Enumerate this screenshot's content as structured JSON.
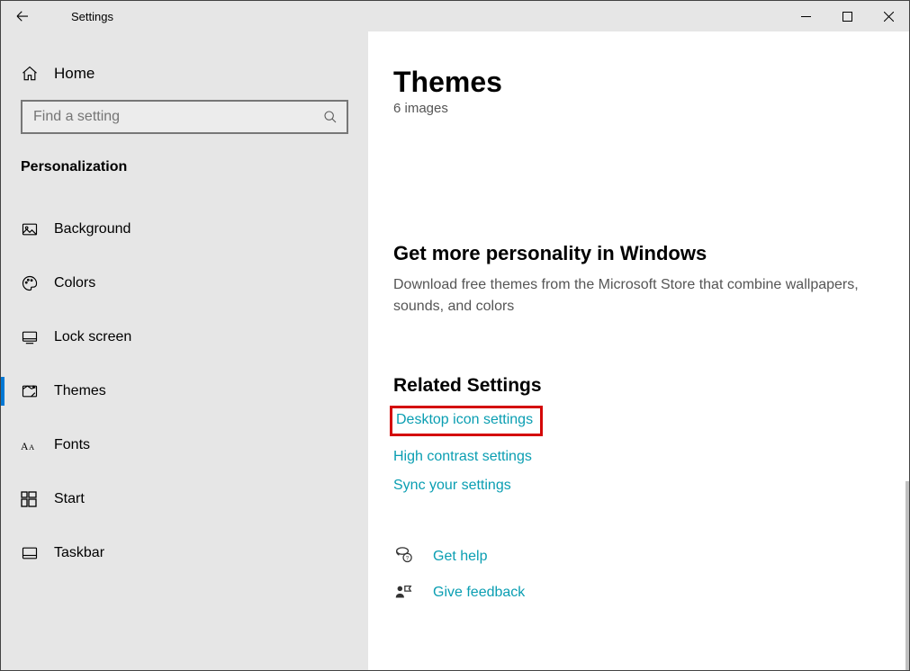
{
  "titlebar": {
    "title": "Settings"
  },
  "sidebar": {
    "home_label": "Home",
    "search_placeholder": "Find a setting",
    "category": "Personalization",
    "items": [
      {
        "label": "Background",
        "name": "background"
      },
      {
        "label": "Colors",
        "name": "colors"
      },
      {
        "label": "Lock screen",
        "name": "lock-screen"
      },
      {
        "label": "Themes",
        "name": "themes"
      },
      {
        "label": "Fonts",
        "name": "fonts"
      },
      {
        "label": "Start",
        "name": "start"
      },
      {
        "label": "Taskbar",
        "name": "taskbar"
      }
    ],
    "active_index": 3
  },
  "main": {
    "title": "Themes",
    "clipped_line": "6 images",
    "promo": {
      "heading": "Get more personality in Windows",
      "body": "Download free themes from the Microsoft Store that combine wallpapers, sounds, and colors"
    },
    "related": {
      "heading": "Related Settings",
      "links": [
        "Desktop icon settings",
        "High contrast settings",
        "Sync your settings"
      ],
      "highlight_index": 0
    },
    "help": [
      "Get help",
      "Give feedback"
    ]
  }
}
